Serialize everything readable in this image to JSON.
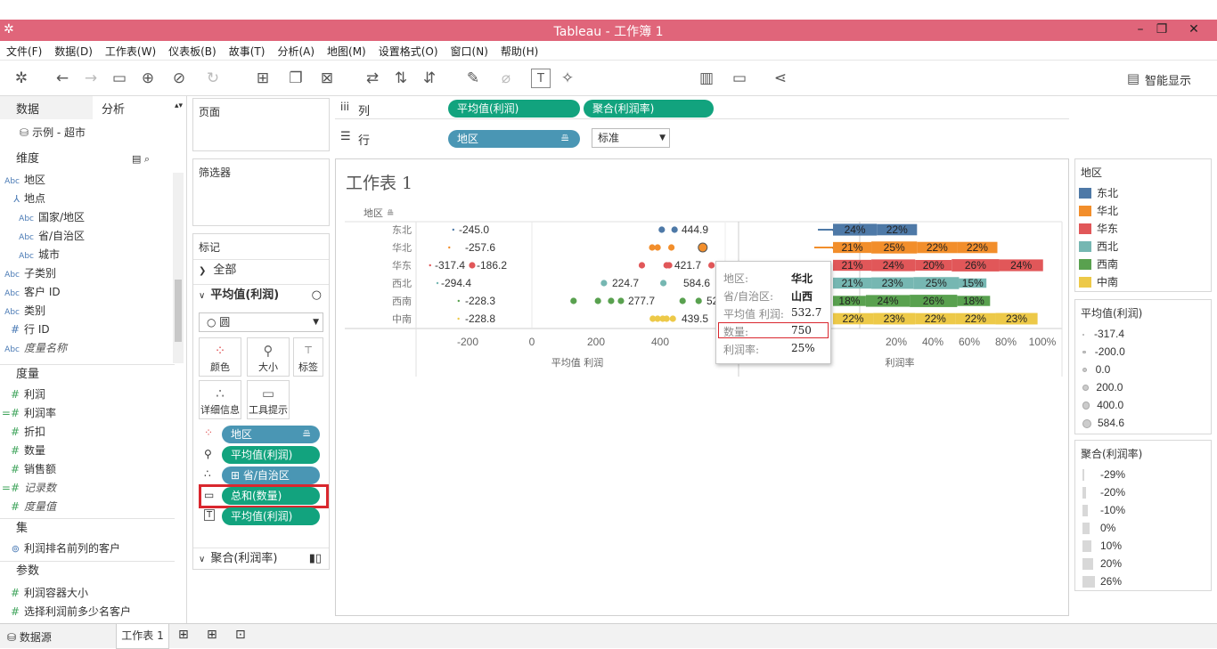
{
  "window": {
    "title": "Tableau - 工作簿 1",
    "minimize": "–",
    "restore": "❐",
    "close": "✕"
  },
  "menu": [
    "文件(F)",
    "数据(D)",
    "工作表(W)",
    "仪表板(B)",
    "故事(T)",
    "分析(A)",
    "地图(M)",
    "设置格式(O)",
    "窗口(N)",
    "帮助(H)"
  ],
  "toolbar": {
    "fit_select": "标准",
    "show_me": "智能显示"
  },
  "left": {
    "tab_data": "数据",
    "tab_analysis": "分析",
    "datasource": "示例 - 超市",
    "dims_header": "维度",
    "dims": [
      {
        "icon": "Abc",
        "label": "地区",
        "indent": 0
      },
      {
        "icon": "hier",
        "label": "地点",
        "indent": 0
      },
      {
        "icon": "Abc",
        "label": "国家/地区",
        "indent": 1
      },
      {
        "icon": "Abc",
        "label": "省/自治区",
        "indent": 1
      },
      {
        "icon": "Abc",
        "label": "城市",
        "indent": 1
      },
      {
        "icon": "Abc",
        "label": "子类别",
        "indent": 0
      },
      {
        "icon": "Abc",
        "label": "客户 ID",
        "indent": 0
      },
      {
        "icon": "Abc",
        "label": "类别",
        "indent": 0
      },
      {
        "icon": "#",
        "label": "行 ID",
        "indent": 0
      },
      {
        "icon": "Abc",
        "label": "度量名称",
        "indent": 0
      }
    ],
    "measures_header": "度量",
    "measures": [
      "利润",
      "利润率",
      "折扣",
      "数量",
      "销售额",
      "记录数",
      "度量值"
    ],
    "sets_header": "集",
    "sets": [
      "利润排名前列的客户"
    ],
    "params_header": "参数",
    "params": [
      "利润容器大小",
      "选择利润前多少名客户"
    ]
  },
  "cards": {
    "pages": "页面",
    "filters": "筛选器",
    "marks": "标记",
    "all": "全部",
    "avg_profit": "平均值(利润)",
    "mark_type": "圆",
    "btn_color": "颜色",
    "btn_size": "大小",
    "btn_label": "标签",
    "btn_detail": "详细信息",
    "btn_tooltip": "工具提示",
    "pill_region": "地区",
    "pill_size": "平均值(利润)",
    "pill_detail": "省/自治区",
    "pill_tooltip": "总和(数量)",
    "pill_label": "平均值(利润)",
    "agg_ratio": "聚合(利润率)"
  },
  "shelves": {
    "cols_label": "列",
    "rows_label": "行",
    "col_pill1": "平均值(利润)",
    "col_pill2": "聚合(利润率)",
    "row_pill": "地区"
  },
  "sheet": {
    "title": "工作表 1",
    "row_header": "地区",
    "x1_title": "平均值 利润",
    "x2_title": "利润率"
  },
  "chart_data": [
    {
      "type": "scatter",
      "categories": [
        "东北",
        "华北",
        "华东",
        "西北",
        "西南",
        "中南"
      ],
      "xlabel": "平均值 利润",
      "xlim": [
        -300,
        580
      ],
      "xticks": [
        "-200",
        "0",
        "200",
        "400"
      ],
      "labeled_values": [
        {
          "region": "东北",
          "labels": [
            "-245.0",
            "444.9"
          ]
        },
        {
          "region": "华北",
          "labels": [
            "-257.6"
          ]
        },
        {
          "region": "华东",
          "labels": [
            "-317.4",
            "-186.2",
            "421.7"
          ]
        },
        {
          "region": "西北",
          "labels": [
            "-294.4",
            "224.7",
            "584.6"
          ]
        },
        {
          "region": "西南",
          "labels": [
            "-228.3",
            "277.7",
            "52"
          ]
        },
        {
          "region": "中南",
          "labels": [
            "-228.8",
            "439.5"
          ]
        }
      ],
      "points": [
        {
          "region": "东北",
          "x": [
            -245,
            405,
            444.9
          ]
        },
        {
          "region": "华北",
          "x": [
            -257.6,
            375,
            392,
            435,
            532.7
          ]
        },
        {
          "region": "华东",
          "x": [
            -317.4,
            -186.2,
            343,
            420,
            428,
            560
          ]
        },
        {
          "region": "西北",
          "x": [
            -294.4,
            224.7,
            410,
            584.6
          ]
        },
        {
          "region": "西南",
          "x": [
            -228.3,
            130,
            206,
            247,
            277.7,
            470,
            520
          ]
        },
        {
          "region": "中南",
          "x": [
            -228.8,
            377,
            392,
            408,
            420,
            439.5
          ]
        }
      ]
    },
    {
      "type": "bar",
      "categories": [
        "东北",
        "华北",
        "华东",
        "西北",
        "西南",
        "中南"
      ],
      "xlabel": "利润率",
      "xticks": [
        "20%",
        "40%",
        "60%",
        "80%",
        "100%"
      ],
      "series": [
        {
          "region": "东北",
          "values": [
            -19,
            24,
            22
          ]
        },
        {
          "region": "华北",
          "values": [
            -21,
            21,
            25,
            22,
            22
          ]
        },
        {
          "region": "华东",
          "values": [
            21,
            24,
            20,
            26,
            24
          ]
        },
        {
          "region": "西北",
          "values": [
            21,
            23,
            25,
            15
          ]
        },
        {
          "region": "西南",
          "values": [
            18,
            24,
            26,
            18
          ]
        },
        {
          "region": "中南",
          "values": [
            22,
            23,
            22,
            22,
            23
          ]
        }
      ]
    }
  ],
  "tooltip": {
    "k1": "地区:",
    "v1": "华北",
    "k2": "省/自治区:",
    "v2": "山西",
    "k3": "平均值 利润:",
    "v3": "532.7",
    "k4": "数量:",
    "v4": "750",
    "k5": "利润率:",
    "v5": "25%"
  },
  "legend_region": {
    "title": "地区",
    "items": [
      {
        "label": "东北",
        "color": "#4e79a7"
      },
      {
        "label": "华北",
        "color": "#f28e2b"
      },
      {
        "label": "华东",
        "color": "#e15759"
      },
      {
        "label": "西北",
        "color": "#76b7b2"
      },
      {
        "label": "西南",
        "color": "#59a14f"
      },
      {
        "label": "中南",
        "color": "#edc948"
      }
    ]
  },
  "legend_size": {
    "title": "平均值(利润)",
    "items": [
      "-317.4",
      "-200.0",
      "0.0",
      "200.0",
      "400.0",
      "584.6"
    ]
  },
  "legend_ratio": {
    "title": "聚合(利润率)",
    "items": [
      "-29%",
      "-20%",
      "-10%",
      "0%",
      "10%",
      "20%",
      "26%"
    ]
  },
  "status": {
    "datasource": "数据源",
    "sheet": "工作表 1"
  }
}
